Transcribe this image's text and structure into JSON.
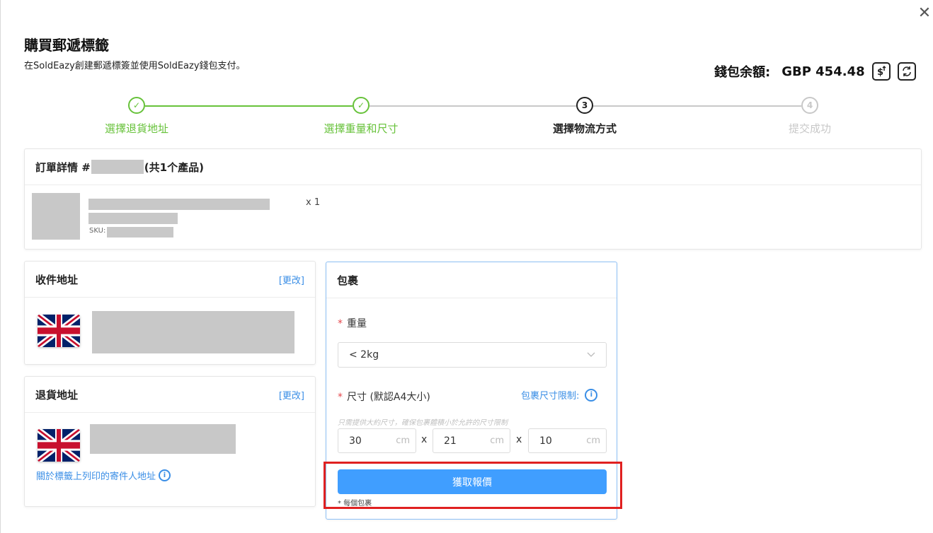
{
  "dialog": {
    "title": "購買郵遞標籤",
    "subtitle": "在SoldEazy創建郵遞標簽並使用SoldEazy錢包支付。",
    "close_label": "✕"
  },
  "wallet": {
    "label": "錢包余額:",
    "value": "GBP 454.48",
    "topup_icon": "dollar-upload-icon",
    "refresh_icon": "refresh-icon"
  },
  "steps": [
    {
      "number": "✓",
      "label": "選擇退貨地址",
      "state": "done"
    },
    {
      "number": "✓",
      "label": "選擇重量和尺寸",
      "state": "done"
    },
    {
      "number": "3",
      "label": "選擇物流方式",
      "state": "active"
    },
    {
      "number": "4",
      "label": "提交成功",
      "state": "pending"
    }
  ],
  "colors": {
    "done": "#67c23a",
    "active": "#222222",
    "pending": "#c8c8c8",
    "primary": "#409eff",
    "highlight": "#e02020"
  },
  "order": {
    "title_prefix": "訂單詳情 #",
    "title_suffix": "(共1个產品)",
    "quantity": "x 1",
    "sku_label": "SKU:"
  },
  "recipient": {
    "title": "收件地址",
    "change_label": "[更改]"
  },
  "return_address": {
    "title": "退貨地址",
    "change_label": "[更改]",
    "sender_info_link": "關於標籤上列印的寄件人地址"
  },
  "package": {
    "title": "包裹",
    "weight_label": "重量",
    "weight_value": "< 2kg",
    "size_label": "尺寸 (默認A4大小)",
    "size_limit_link": "包裹尺寸限制:",
    "hint": "只需提供大約尺寸，確保包裹體積小於允許的尺寸限制",
    "length": "30",
    "width": "21",
    "height": "10",
    "unit": "cm",
    "times": "x",
    "quote_button": "獲取報價",
    "per_package_note": "* 每個包裹"
  }
}
